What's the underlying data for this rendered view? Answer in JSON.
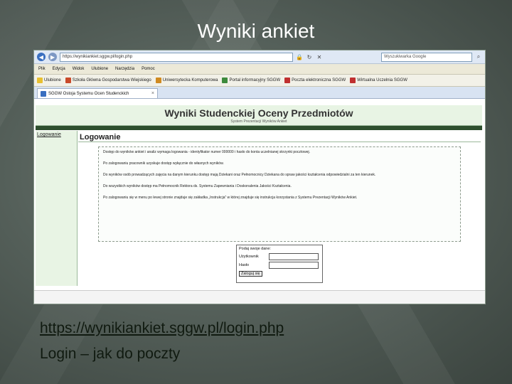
{
  "slide": {
    "title": "Wyniki ankiet",
    "link": "https://wynikiankiet.sggw.pl/login.php",
    "caption": "Login – jak do poczty"
  },
  "browser": {
    "url": "https://wynikiankiet.sggw.pl/login.php",
    "search_placeholder": "Wyszukiwarka Google",
    "menu": [
      "Plik",
      "Edycja",
      "Widok",
      "Ulubione",
      "Narzędzia",
      "Pomoc"
    ],
    "favorites_label": "Ulubione",
    "favorites": [
      {
        "label": "Szkoła Główna Gospodarstwa Wiejskiego",
        "color": "#c94a2a"
      },
      {
        "label": "Uniwersytecka Komputerowa",
        "color": "#d08a20"
      },
      {
        "label": "Portal informacyjny SGGW",
        "color": "#3d8a3d"
      },
      {
        "label": "Poczta elektroniczna SGGW",
        "color": "#c03030"
      },
      {
        "label": "Wirtualna Uczelnia SGGW",
        "color": "#c03030"
      }
    ],
    "tab_label": "SGGW Ostoja Systemu Ocen Studenckich"
  },
  "site": {
    "title": "Wyniki Studenckiej Oceny Przedmiotów",
    "subtitle": "System Prezentacji Wyników Ankiet",
    "sidebar_link": "Logowanie",
    "content_title": "Logowanie",
    "paragraphs": [
      "Dostęp do wyników ankiet i analiz wymaga logowania - identyfikator numer 000000 i hasło do konta uczelnianej skrzynki pocztowej.",
      "Po zalogowaniu pracownik uzyskuje dostęp wyłącznie do własnych wyników.",
      "Do wyników osób prowadzących zajęcia na danym kierunku dostęp mają Dziekani oraz Pełnomocnicy Dziekana do spraw jakości kształcenia odpowiedzialni za ten kierunek.",
      "Do wszystkich wyników dostęp ma Pełnomocnik Rektora ds. Systemu Zapewniania i Doskonalenia Jakości Kształcenia.",
      "Po zalogowaniu się w menu po lewej stronie znajduje się zakładka „Instrukcja” w której znajduje się instrukcja korzystania z Systemu Prezentacji Wyników Ankiet."
    ],
    "login": {
      "header": "Podaj swoje dane:",
      "user_label": "Użytkownik",
      "pass_label": "Hasło",
      "button": "Zaloguj się"
    }
  }
}
